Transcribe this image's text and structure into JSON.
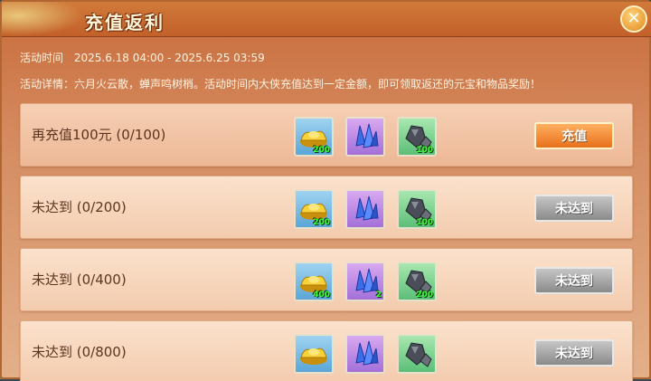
{
  "window": {
    "title": "充值返利",
    "close_icon": "close-icon"
  },
  "info": {
    "time_label": "活动时间",
    "time_range": "2025.6.18 04:00 - 2025.6.25 03:59",
    "detail_label": "活动详情：",
    "detail_text": "六月火云散，蝉声鸣树梢。活动时间内大侠充值达到一定金额，即可领取返还的元宝和物品奖励！"
  },
  "tiers": [
    {
      "label": "再充值100元 (0/100)",
      "button": "充值",
      "button_state": "active",
      "rewards": [
        {
          "icon": "gold-ingot-icon",
          "qty": "200"
        },
        {
          "icon": "blue-crystal-icon",
          "qty": ""
        },
        {
          "icon": "ore-stone-icon",
          "qty": "100"
        }
      ]
    },
    {
      "label": "未达到 (0/200)",
      "button": "未达到",
      "button_state": "disabled",
      "rewards": [
        {
          "icon": "gold-ingot-icon",
          "qty": "200"
        },
        {
          "icon": "blue-crystal-icon",
          "qty": ""
        },
        {
          "icon": "ore-stone-icon",
          "qty": "100"
        }
      ]
    },
    {
      "label": "未达到 (0/400)",
      "button": "未达到",
      "button_state": "disabled",
      "rewards": [
        {
          "icon": "gold-ingot-icon",
          "qty": "400"
        },
        {
          "icon": "blue-crystal-icon",
          "qty": "2"
        },
        {
          "icon": "ore-stone-icon",
          "qty": "200"
        }
      ]
    },
    {
      "label": "未达到 (0/800)",
      "button": "未达到",
      "button_state": "disabled",
      "rewards": [
        {
          "icon": "gold-ingot-icon",
          "qty": ""
        },
        {
          "icon": "blue-crystal-icon",
          "qty": ""
        },
        {
          "icon": "ore-stone-icon",
          "qty": ""
        }
      ]
    }
  ],
  "colors": {
    "title_bar": "#c2602a",
    "panel": "#d48a5e",
    "charge_button": "#e8701c",
    "disabled_button": "#8a8a8a",
    "qty_text": "#3cff3c"
  }
}
